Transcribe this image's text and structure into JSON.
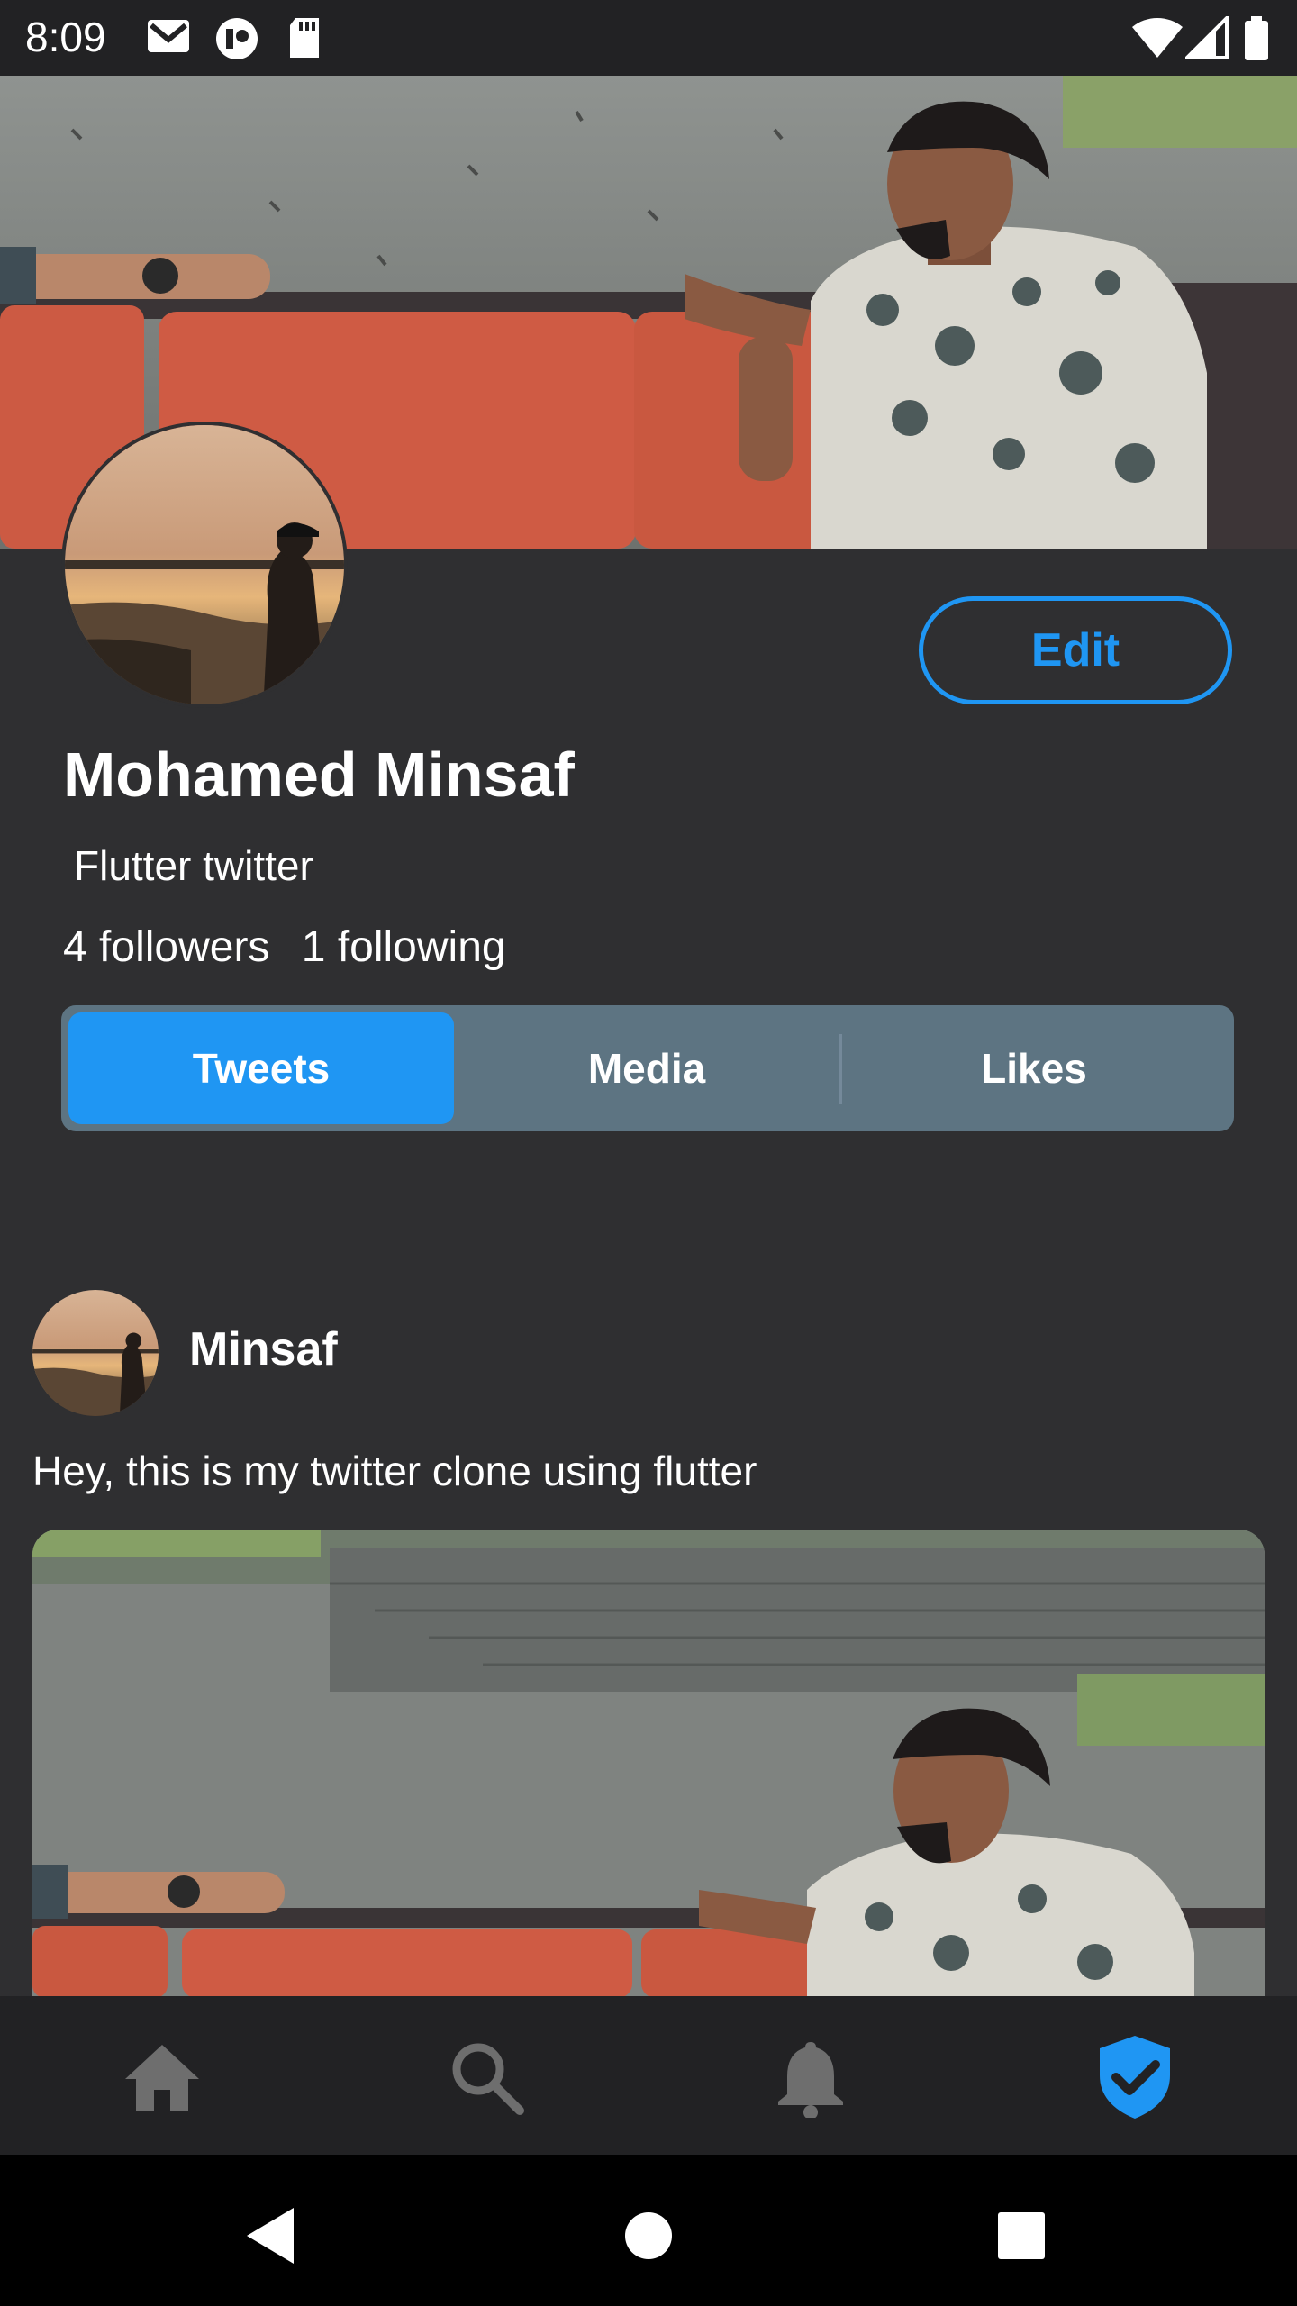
{
  "status_bar": {
    "time": "8:09",
    "icons": [
      "gmail-icon",
      "app-icon",
      "sd-card-icon",
      "wifi-icon",
      "signal-icon",
      "battery-icon"
    ]
  },
  "profile": {
    "name": "Mohamed Minsaf",
    "bio": "Flutter twitter",
    "followers": "4 followers",
    "following": "1 following",
    "edit_label": "Edit"
  },
  "tabs": [
    {
      "label": "Tweets",
      "active": true
    },
    {
      "label": "Media",
      "active": false
    },
    {
      "label": "Likes",
      "active": false
    }
  ],
  "tweet": {
    "author": "Minsaf",
    "text": "Hey, this is my twitter clone using flutter"
  },
  "bottom_nav": [
    "home-icon",
    "search-icon",
    "bell-icon",
    "verified-shield-icon"
  ],
  "colors": {
    "accent": "#1f96f3",
    "background": "#2f2f31",
    "tab_bar": "#5d7482",
    "nav_inactive": "#6e6e6e"
  }
}
